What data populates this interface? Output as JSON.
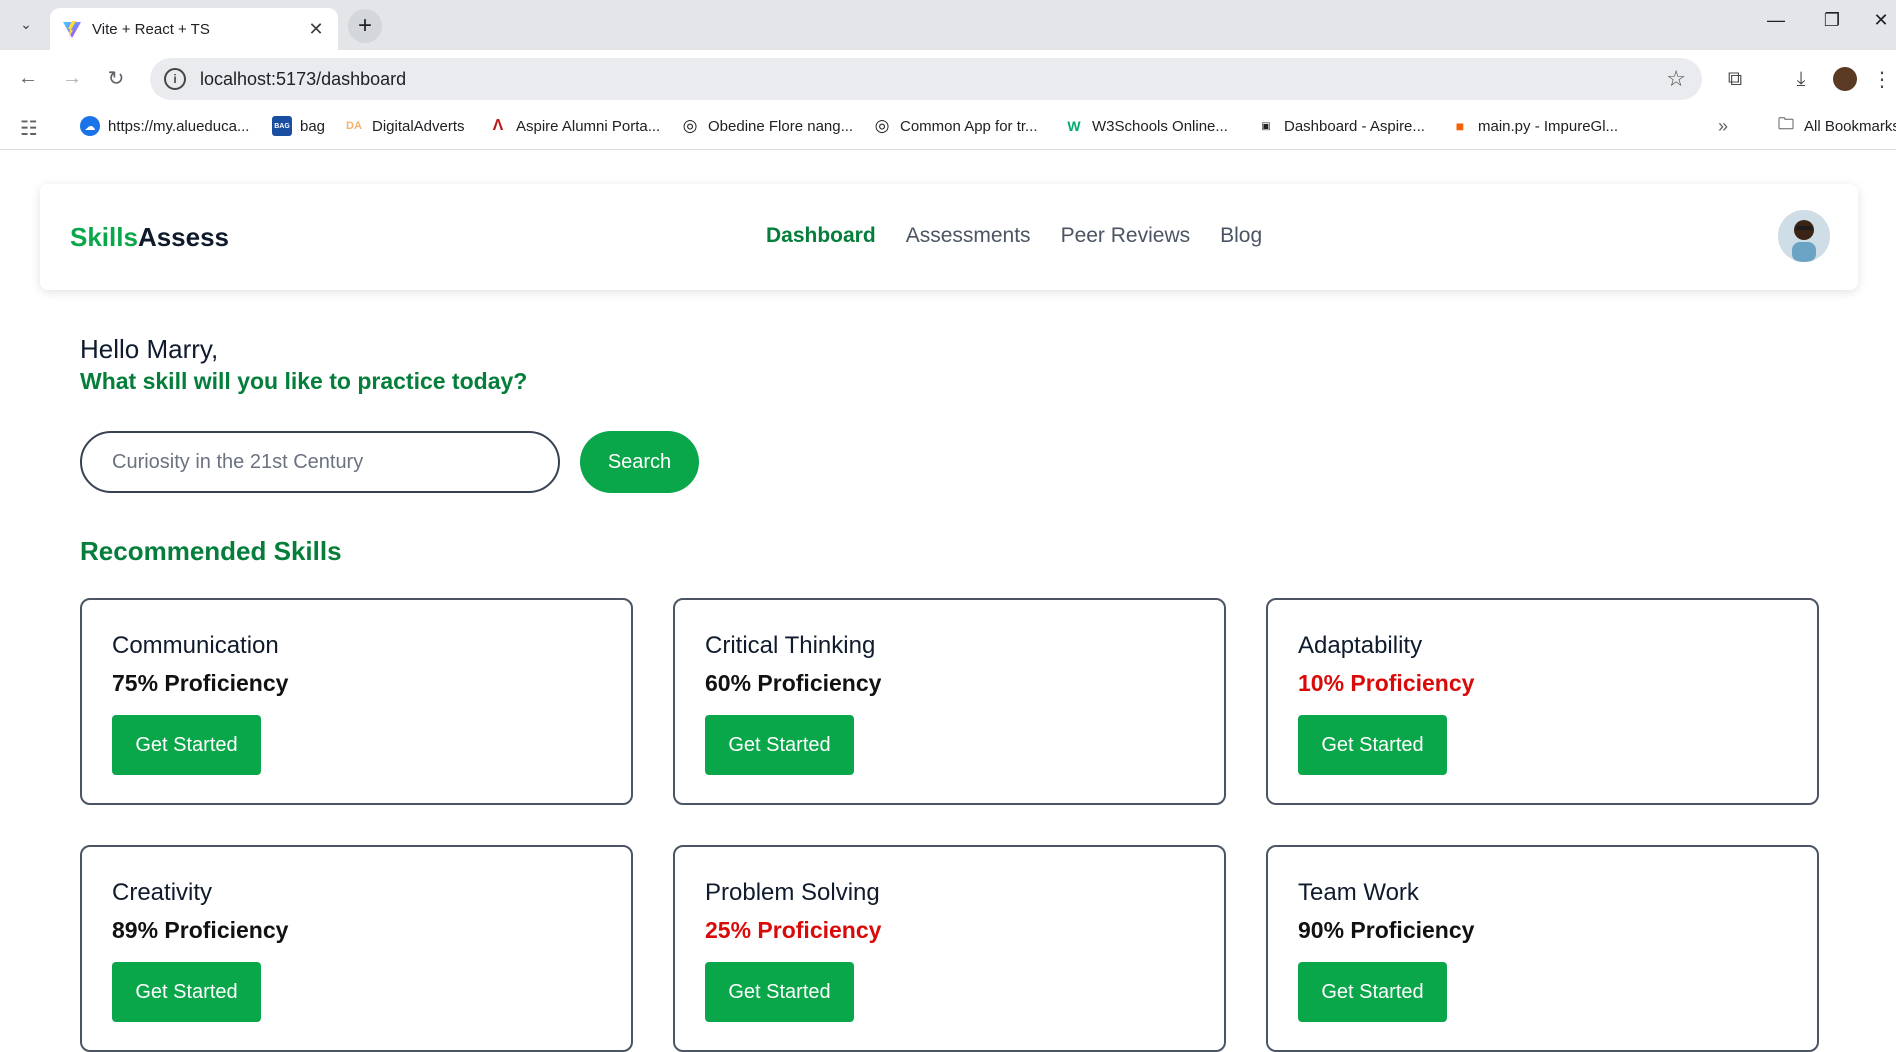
{
  "browser": {
    "tab_title": "Vite + React + TS",
    "url": "localhost:5173/dashboard",
    "bookmarks": [
      {
        "label": "https://my.alueduca...",
        "icon": "cloud-icon",
        "color": "#1a73e8"
      },
      {
        "label": "bag",
        "icon": "bag-icon",
        "color": "#1a4ea1"
      },
      {
        "label": "DigitalAdverts",
        "icon": "da-icon",
        "color": "#f6b26b"
      },
      {
        "label": "Aspire Alumni Porta...",
        "icon": "aspire-icon",
        "color": "#b71c1c"
      },
      {
        "label": "Obedine Flore nang...",
        "icon": "globe-icon",
        "color": "#202124"
      },
      {
        "label": "Common App for tr...",
        "icon": "globe-icon",
        "color": "#202124"
      },
      {
        "label": "W3Schools Online...",
        "icon": "w3schools-icon",
        "color": "#04aa6d"
      },
      {
        "label": "Dashboard - Aspire...",
        "icon": "dashboard-icon",
        "color": "#202124"
      },
      {
        "label": "main.py - ImpureGl...",
        "icon": "replit-icon",
        "color": "#f26207"
      }
    ],
    "all_bookmarks": "All Bookmarks"
  },
  "app": {
    "brand_part1": "Skills",
    "brand_part2": "Assess",
    "nav": [
      {
        "label": "Dashboard",
        "active": true
      },
      {
        "label": "Assessments",
        "active": false
      },
      {
        "label": "Peer Reviews",
        "active": false
      },
      {
        "label": "Blog",
        "active": false
      }
    ]
  },
  "main": {
    "greeting": "Hello Marry,",
    "prompt": "What skill will you like to practice today?",
    "search_placeholder": "Curiosity in the 21st Century",
    "search_button": "Search",
    "section_title": "Recommended Skills",
    "skills": [
      {
        "name": "Communication",
        "proficiency": "75% Proficiency",
        "low": false,
        "button": "Get Started"
      },
      {
        "name": "Critical Thinking",
        "proficiency": "60% Proficiency",
        "low": false,
        "button": "Get Started"
      },
      {
        "name": "Adaptability",
        "proficiency": "10% Proficiency",
        "low": true,
        "button": "Get Started"
      },
      {
        "name": "Creativity",
        "proficiency": "89% Proficiency",
        "low": false,
        "button": "Get Started"
      },
      {
        "name": "Problem Solving",
        "proficiency": "25% Proficiency",
        "low": true,
        "button": "Get Started"
      },
      {
        "name": "Team Work",
        "proficiency": "90% Proficiency",
        "low": false,
        "button": "Get Started"
      }
    ]
  },
  "colors": {
    "brand_green": "#0aa64a",
    "dark_green": "#047e3a",
    "low_red": "#d90a0a"
  }
}
